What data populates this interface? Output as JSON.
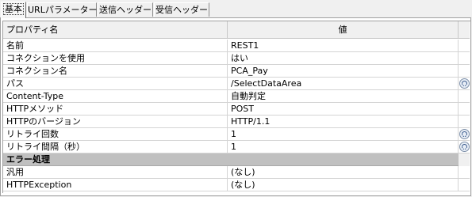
{
  "tabs": [
    {
      "label": "基本"
    },
    {
      "label": "URLパラメーター"
    },
    {
      "label": "送信ヘッダー"
    },
    {
      "label": "受信ヘッダー"
    }
  ],
  "grid": {
    "header": {
      "property": "プロパティ名",
      "value": "値"
    },
    "rows": [
      {
        "key": "名前",
        "value": "REST1"
      },
      {
        "key": "コネクションを使用",
        "value": "はい"
      },
      {
        "key": "コネクション名",
        "value": "PCA_Pay"
      },
      {
        "key": "パス",
        "value": "/SelectDataArea"
      },
      {
        "key": "Content-Type",
        "value": "自動判定"
      },
      {
        "key": "HTTPメソッド",
        "value": "POST"
      },
      {
        "key": "HTTPのバージョン",
        "value": "HTTP/1.1"
      },
      {
        "key": "リトライ回数",
        "value": "1"
      },
      {
        "key": "リトライ間隔（秒）",
        "value": "1"
      }
    ],
    "section": {
      "label": "エラー処理"
    },
    "section_rows": [
      {
        "key": "汎用",
        "value": "(なし)"
      },
      {
        "key": "HTTPException",
        "value": "(なし)"
      }
    ]
  },
  "icons": {
    "variable_button": "variable-icon"
  }
}
